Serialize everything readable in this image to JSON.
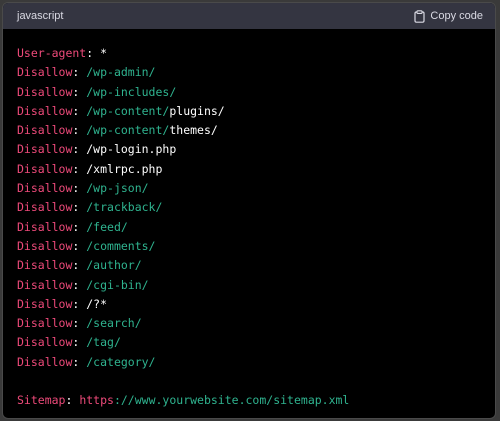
{
  "header": {
    "language": "javascript",
    "copy_label": "Copy code"
  },
  "lines": [
    [
      {
        "t": "User-agent",
        "c": "kw"
      },
      {
        "t": ": ",
        "c": "punct"
      },
      {
        "t": "*",
        "c": "val"
      }
    ],
    [
      {
        "t": "Disallow",
        "c": "kw"
      },
      {
        "t": ": ",
        "c": "punct"
      },
      {
        "t": "/wp-admin/",
        "c": "path"
      }
    ],
    [
      {
        "t": "Disallow",
        "c": "kw"
      },
      {
        "t": ": ",
        "c": "punct"
      },
      {
        "t": "/wp-includes/",
        "c": "path"
      }
    ],
    [
      {
        "t": "Disallow",
        "c": "kw"
      },
      {
        "t": ": ",
        "c": "punct"
      },
      {
        "t": "/wp-content/",
        "c": "path"
      },
      {
        "t": "plugins/",
        "c": "val"
      }
    ],
    [
      {
        "t": "Disallow",
        "c": "kw"
      },
      {
        "t": ": ",
        "c": "punct"
      },
      {
        "t": "/wp-content/",
        "c": "path"
      },
      {
        "t": "themes/",
        "c": "val"
      }
    ],
    [
      {
        "t": "Disallow",
        "c": "kw"
      },
      {
        "t": ": ",
        "c": "punct"
      },
      {
        "t": "/wp-login.php",
        "c": "val"
      }
    ],
    [
      {
        "t": "Disallow",
        "c": "kw"
      },
      {
        "t": ": ",
        "c": "punct"
      },
      {
        "t": "/xmlrpc.php",
        "c": "val"
      }
    ],
    [
      {
        "t": "Disallow",
        "c": "kw"
      },
      {
        "t": ": ",
        "c": "punct"
      },
      {
        "t": "/wp-json/",
        "c": "path"
      }
    ],
    [
      {
        "t": "Disallow",
        "c": "kw"
      },
      {
        "t": ": ",
        "c": "punct"
      },
      {
        "t": "/trackback/",
        "c": "path"
      }
    ],
    [
      {
        "t": "Disallow",
        "c": "kw"
      },
      {
        "t": ": ",
        "c": "punct"
      },
      {
        "t": "/feed/",
        "c": "path"
      }
    ],
    [
      {
        "t": "Disallow",
        "c": "kw"
      },
      {
        "t": ": ",
        "c": "punct"
      },
      {
        "t": "/comments/",
        "c": "path"
      }
    ],
    [
      {
        "t": "Disallow",
        "c": "kw"
      },
      {
        "t": ": ",
        "c": "punct"
      },
      {
        "t": "/author/",
        "c": "path"
      }
    ],
    [
      {
        "t": "Disallow",
        "c": "kw"
      },
      {
        "t": ": ",
        "c": "punct"
      },
      {
        "t": "/cgi-bin/",
        "c": "path"
      }
    ],
    [
      {
        "t": "Disallow",
        "c": "kw"
      },
      {
        "t": ": ",
        "c": "punct"
      },
      {
        "t": "/?*",
        "c": "val"
      }
    ],
    [
      {
        "t": "Disallow",
        "c": "kw"
      },
      {
        "t": ": ",
        "c": "punct"
      },
      {
        "t": "/search/",
        "c": "path"
      }
    ],
    [
      {
        "t": "Disallow",
        "c": "kw"
      },
      {
        "t": ": ",
        "c": "punct"
      },
      {
        "t": "/tag/",
        "c": "path"
      }
    ],
    [
      {
        "t": "Disallow",
        "c": "kw"
      },
      {
        "t": ": ",
        "c": "punct"
      },
      {
        "t": "/category/",
        "c": "path"
      }
    ],
    [],
    [
      {
        "t": "Sitemap",
        "c": "kw"
      },
      {
        "t": ": ",
        "c": "punct"
      },
      {
        "t": "https",
        "c": "proto"
      },
      {
        "t": "://www.yourwebsite.com/sitemap.xml",
        "c": "path"
      }
    ]
  ],
  "colors": {
    "keyword": "#ee4a7a",
    "path": "#2fb38f",
    "plain": "#ffffff",
    "header_bg": "#343541",
    "code_bg": "#000000"
  }
}
